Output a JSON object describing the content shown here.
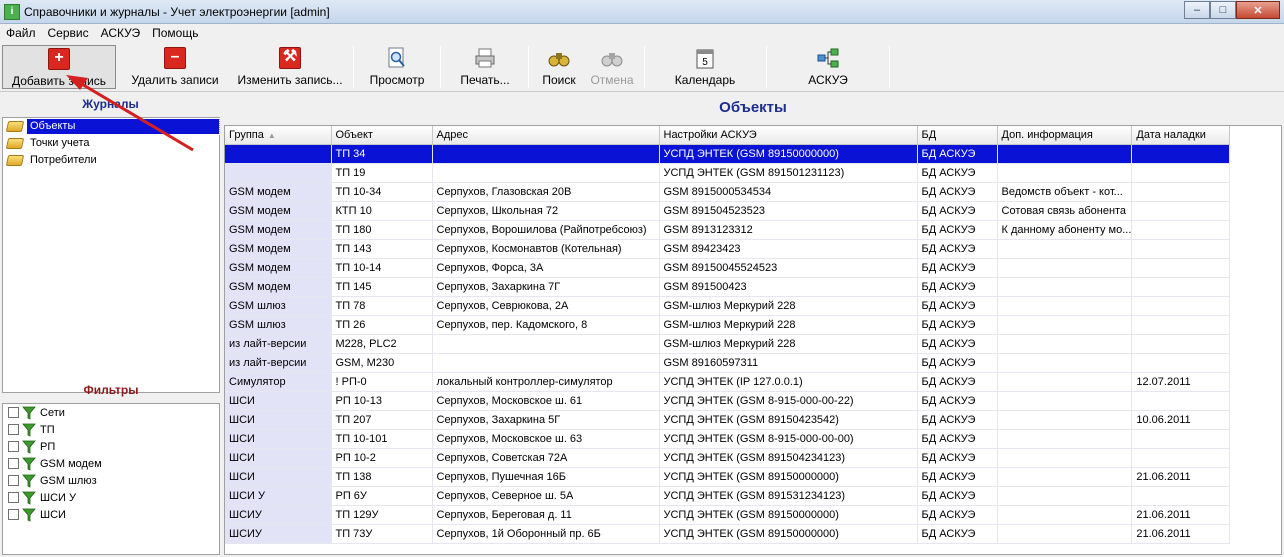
{
  "window": {
    "title": "Справочники и журналы - Учет электроэнергии [admin]"
  },
  "menu": [
    "Файл",
    "Сервис",
    "АСКУЭ",
    "Помощь"
  ],
  "toolbar": {
    "add": "Добавить запись",
    "delete": "Удалить записи",
    "edit": "Изменить запись...",
    "preview": "Просмотр",
    "print": "Печать...",
    "search": "Поиск",
    "cancel": "Отмена",
    "calendar": "Календарь",
    "askue": "АСКУЭ",
    "calendar_day": "5"
  },
  "journals": {
    "title": "Журналы",
    "items": [
      {
        "label": "Объекты",
        "selected": true
      },
      {
        "label": "Точки учета",
        "selected": false
      },
      {
        "label": "Потребители",
        "selected": false
      }
    ]
  },
  "filters": {
    "title": "Фильтры",
    "items": [
      "Сети",
      "ТП",
      "РП",
      "GSM модем",
      "GSM шлюз",
      "ШСИ У",
      "ШСИ"
    ]
  },
  "main": {
    "title": "Объекты",
    "columns": [
      "Группа",
      "Объект",
      "Адрес",
      "Настройки АСКУЭ",
      "БД",
      "Доп. информация",
      "Дата наладки"
    ],
    "rows": [
      [
        "",
        "ТП 34",
        "",
        "УСПД ЭНТЕК (GSM 89150000000)",
        "БД АСКУЭ",
        "",
        ""
      ],
      [
        "",
        "ТП 19",
        "",
        "УСПД ЭНТЕК (GSM 891501231123)",
        "БД АСКУЭ",
        "",
        ""
      ],
      [
        "GSM модем",
        "ТП 10-34",
        "Серпухов, Глазовская 20В",
        "GSM 8915000534534",
        "БД АСКУЭ",
        "Ведомств объект - кот...",
        ""
      ],
      [
        "GSM модем",
        "КТП 10",
        "Серпухов, Школьная 72",
        "GSM 891504523523",
        "БД АСКУЭ",
        "Сотовая связь абонента",
        ""
      ],
      [
        "GSM модем",
        "ТП 180",
        "Серпухов, Ворошилова (Райпотребсоюз)",
        "GSM 8913123312",
        "БД АСКУЭ",
        "К данному абоненту мо...",
        ""
      ],
      [
        "GSM модем",
        "ТП 143",
        "Серпухов, Космонавтов (Котельная)",
        "GSM 89423423",
        "БД АСКУЭ",
        "",
        ""
      ],
      [
        "GSM модем",
        "ТП 10-14",
        "Серпухов, Форса, 3А",
        "GSM 89150045524523",
        "БД АСКУЭ",
        "",
        ""
      ],
      [
        "GSM модем",
        "ТП 145",
        "Серпухов, Захаркина 7Г",
        "GSM 891500423",
        "БД АСКУЭ",
        "",
        ""
      ],
      [
        "GSM шлюз",
        "ТП 78",
        "Серпухов, Севрюкова, 2А",
        "GSM-шлюз Меркурий 228",
        "БД АСКУЭ",
        "",
        ""
      ],
      [
        "GSM шлюз",
        "ТП 26",
        "Серпухов, пер. Кадомского, 8",
        "GSM-шлюз Меркурий 228",
        "БД АСКУЭ",
        "",
        ""
      ],
      [
        "из лайт-версии",
        "М228, PLC2",
        "",
        "GSM-шлюз Меркурий 228",
        "БД АСКУЭ",
        "",
        ""
      ],
      [
        "из лайт-версии",
        "GSM, M230",
        "",
        "GSM 89160597311",
        "БД АСКУЭ",
        "",
        ""
      ],
      [
        "Симулятор",
        "! РП-0",
        "локальный контроллер-симулятор",
        "УСПД ЭНТЕК (IP 127.0.0.1)",
        "БД АСКУЭ",
        "",
        "12.07.2011"
      ],
      [
        "ШСИ",
        "РП 10-13",
        "Серпухов, Московское ш. 61",
        "УСПД ЭНТЕК (GSM 8-915-000-00-22)",
        "БД АСКУЭ",
        "",
        ""
      ],
      [
        "ШСИ",
        "ТП 207",
        "Серпухов, Захаркина 5Г",
        "УСПД ЭНТЕК (GSM 89150423542)",
        "БД АСКУЭ",
        "",
        "10.06.2011"
      ],
      [
        "ШСИ",
        "ТП 10-101",
        "Серпухов, Московское ш. 63",
        "УСПД ЭНТЕК (GSM 8-915-000-00-00)",
        "БД АСКУЭ",
        "",
        ""
      ],
      [
        "ШСИ",
        "РП 10-2",
        "Серпухов, Советская 72А",
        "УСПД ЭНТЕК (GSM 891504234123)",
        "БД АСКУЭ",
        "",
        ""
      ],
      [
        "ШСИ",
        "ТП 138",
        "Серпухов, Пушечная 16Б",
        "УСПД ЭНТЕК (GSM 89150000000)",
        "БД АСКУЭ",
        "",
        "21.06.2011"
      ],
      [
        "ШСИ У",
        "РП 6У",
        "Серпухов, Северное ш. 5А",
        "УСПД ЭНТЕК (GSM 891531234123)",
        "БД АСКУЭ",
        "",
        ""
      ],
      [
        "ШСИУ",
        "ТП 129У",
        "Серпухов, Береговая д. 11",
        "УСПД ЭНТЕК (GSM 89150000000)",
        "БД АСКУЭ",
        "",
        "21.06.2011"
      ],
      [
        "ШСИУ",
        "ТП 73У",
        "Серпухов, 1й Оборонный пр. 6Б",
        "УСПД ЭНТЕК (GSM 89150000000)",
        "БД АСКУЭ",
        "",
        "21.06.2011"
      ]
    ],
    "selected_row": 0
  },
  "colors": {
    "selection": "#0a12d6",
    "heading_blue": "#1c2d8f",
    "heading_red": "#8b1a1a",
    "annotation": "#d42020"
  }
}
